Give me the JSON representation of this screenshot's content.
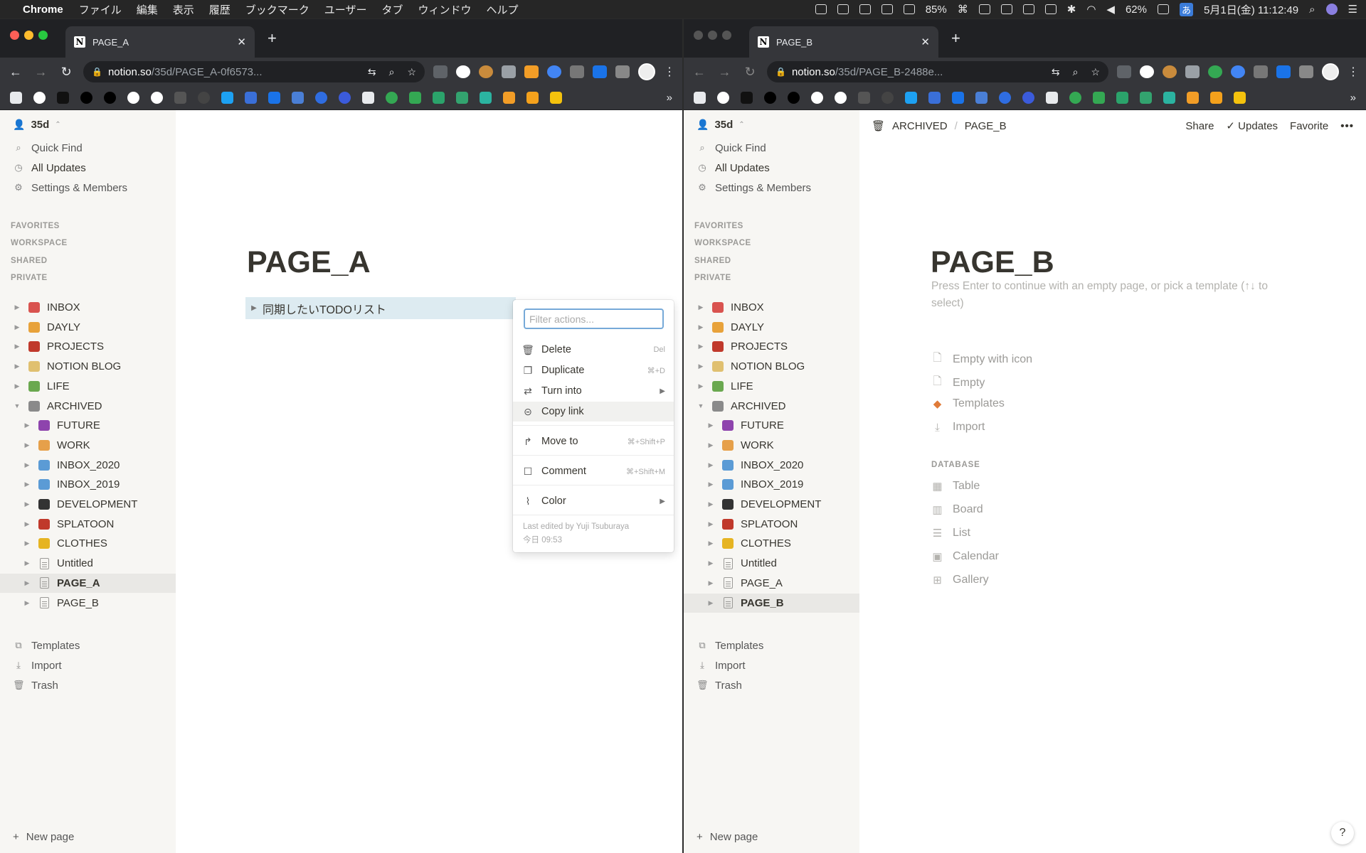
{
  "menubar": {
    "app": "Chrome",
    "items": [
      "ファイル",
      "編集",
      "表示",
      "履歴",
      "ブックマーク",
      "ユーザー",
      "タブ",
      "ウィンドウ",
      "ヘルプ"
    ],
    "battery_a": "85%",
    "battery_b": "62%",
    "ime": "あ",
    "datetime": "5月1日(金) 11:12:49"
  },
  "windows": [
    {
      "tab_title": "PAGE_A",
      "url_host": "notion.so",
      "url_path": "/35d/PAGE_A-0f6573..."
    },
    {
      "tab_title": "PAGE_B",
      "url_host": "notion.so",
      "url_path": "/35d/PAGE_B-2488e..."
    }
  ],
  "sidebar": {
    "workspace": "35d",
    "quick_find": "Quick Find",
    "all_updates": "All Updates",
    "settings": "Settings & Members",
    "sections": [
      "FAVORITES",
      "WORKSPACE",
      "SHARED",
      "PRIVATE"
    ],
    "pages": [
      {
        "label": "INBOX",
        "icon": "inbox-tray-icon",
        "color": "#d9534f",
        "depth": 0,
        "open": false
      },
      {
        "label": "DAYLY",
        "icon": "notebook-icon",
        "color": "#e8a23a",
        "depth": 0,
        "open": false
      },
      {
        "label": "PROJECTS",
        "icon": "rocket-icon",
        "color": "#c0392b",
        "depth": 0,
        "open": false
      },
      {
        "label": "NOTION BLOG",
        "icon": "memo-icon",
        "color": "#e0c070",
        "depth": 0,
        "open": false
      },
      {
        "label": "LIFE",
        "icon": "house-icon",
        "color": "#6aa84f",
        "depth": 0,
        "open": false
      },
      {
        "label": "ARCHIVED",
        "icon": "wastebasket-icon",
        "color": "#8a8a8a",
        "depth": 0,
        "open": true
      },
      {
        "label": "FUTURE",
        "icon": "devil-icon",
        "color": "#8e44ad",
        "depth": 1,
        "open": false
      },
      {
        "label": "WORK",
        "icon": "office-worker-icon",
        "color": "#e6a04a",
        "depth": 1,
        "open": false
      },
      {
        "label": "INBOX_2020",
        "icon": "ballot-box-icon",
        "color": "#5b9bd5",
        "depth": 1,
        "open": false
      },
      {
        "label": "INBOX_2019",
        "icon": "ballot-box-icon",
        "color": "#5b9bd5",
        "depth": 1,
        "open": false
      },
      {
        "label": "DEVELOPMENT",
        "icon": "laptop-icon",
        "color": "#333333",
        "depth": 1,
        "open": false
      },
      {
        "label": "SPLATOON",
        "icon": "octopus-icon",
        "color": "#c0392b",
        "depth": 1,
        "open": false
      },
      {
        "label": "CLOTHES",
        "icon": "tag-icon",
        "color": "#e6b422",
        "depth": 1,
        "open": false
      },
      {
        "label": "Untitled",
        "icon": "page-icon",
        "color": "",
        "depth": 1,
        "open": false
      },
      {
        "label": "PAGE_A",
        "icon": "page-icon",
        "color": "",
        "depth": 1,
        "open": false
      },
      {
        "label": "PAGE_B",
        "icon": "page-icon",
        "color": "",
        "depth": 1,
        "open": false
      }
    ],
    "templates": "Templates",
    "import": "Import",
    "trash": "Trash",
    "new_page": "New page"
  },
  "page_a": {
    "title": "PAGE_A",
    "toggle_text": "同期したいTODOリスト",
    "menu": {
      "filter_placeholder": "Filter actions...",
      "items": [
        {
          "label": "Delete",
          "shortcut": "Del"
        },
        {
          "label": "Duplicate",
          "shortcut": "⌘+D"
        },
        {
          "label": "Turn into",
          "shortcut": ""
        },
        {
          "label": "Copy link",
          "shortcut": ""
        },
        {
          "label": "Move to",
          "shortcut": "⌘+Shift+P"
        },
        {
          "label": "Comment",
          "shortcut": "⌘+Shift+M"
        },
        {
          "label": "Color",
          "shortcut": ""
        }
      ],
      "last_edited": "Last edited by Yuji Tsuburaya",
      "edited_time": "今日 09:53"
    }
  },
  "page_b": {
    "breadcrumb_parent": "ARCHIVED",
    "breadcrumb_current": "PAGE_B",
    "share": "Share",
    "updates": "Updates",
    "favorite": "Favorite",
    "title": "PAGE_B",
    "hint": "Press Enter to continue with an empty page, or pick a template (↑↓ to select)",
    "options": [
      "Empty with icon",
      "Empty",
      "Templates",
      "Import"
    ],
    "database_heading": "DATABASE",
    "database_options": [
      "Table",
      "Board",
      "List",
      "Calendar",
      "Gallery"
    ],
    "help": "?"
  }
}
